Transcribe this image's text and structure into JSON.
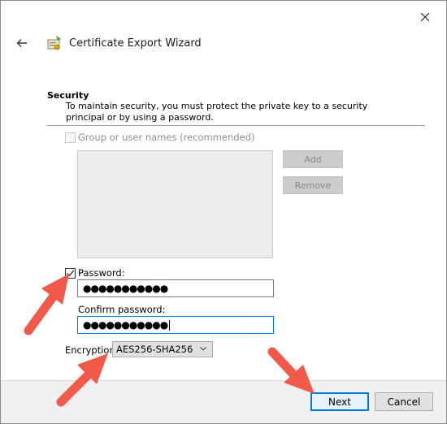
{
  "window": {
    "title": "Certificate Export Wizard",
    "close_icon": "close-icon",
    "back_icon": "back-arrow-icon",
    "wizard_icon": "certificate-wizard-icon"
  },
  "security": {
    "heading": "Security",
    "description": "To maintain security, you must protect the private key to a security principal or by using a password."
  },
  "group_option": {
    "label": "Group or user names (recommended)",
    "checked": false,
    "enabled": false
  },
  "group_buttons": {
    "add_label": "Add",
    "remove_label": "Remove"
  },
  "password": {
    "label": "Password:",
    "checked": true,
    "value": "●●●●●●●●●●●"
  },
  "confirm_password": {
    "label": "Confirm password:",
    "value": "●●●●●●●●●●●"
  },
  "encryption": {
    "label": "Encryption:",
    "selected": "AES256-SHA256"
  },
  "footer": {
    "next_label": "Next",
    "cancel_label": "Cancel"
  },
  "colors": {
    "accent": "#0078d7",
    "annotation_arrow": "#f15a4a"
  }
}
